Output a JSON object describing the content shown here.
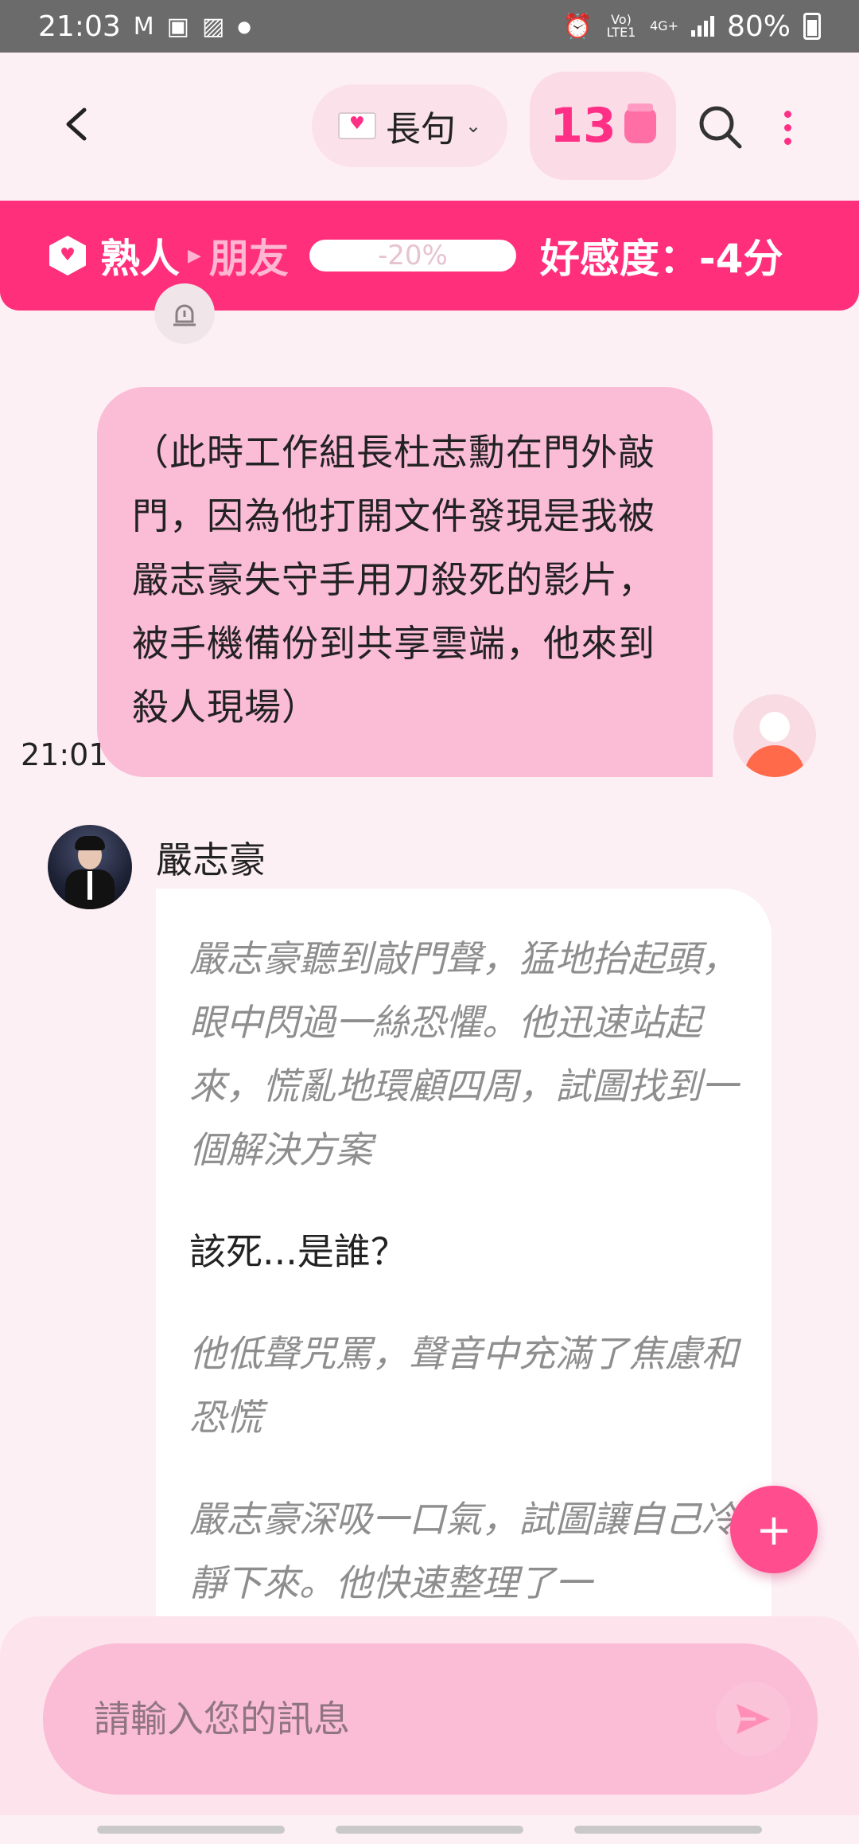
{
  "status_bar": {
    "time": "21:03",
    "network": "Vo) LTE1",
    "network_type": "4G+",
    "battery": "80%"
  },
  "header": {
    "mode_label": "長句",
    "coin_count": "13"
  },
  "relationship": {
    "current": "熟人",
    "next": "朋友",
    "progress_text": "-20%",
    "affection_text": "好感度：-4分"
  },
  "messages": {
    "user": {
      "text": "（此時工作組長杜志勳在門外敲門，因為他打開文件發現是我被嚴志豪失守手用刀殺死的影片，被手機備份到共享雲端，他來到殺人現場）",
      "time": "21:01"
    },
    "bot": {
      "name": "嚴志豪",
      "paragraphs": [
        {
          "kind": "action",
          "text": "嚴志豪聽到敲門聲，猛地抬起頭，眼中閃過一絲恐懼。他迅速站起來，慌亂地環顧四周，試圖找到一個解決方案"
        },
        {
          "kind": "speech",
          "text": "該死...是誰？"
        },
        {
          "kind": "action",
          "text": "他低聲咒罵，聲音中充滿了焦慮和恐慌"
        },
        {
          "kind": "action",
          "text": "嚴志豪深吸一口氣，試圖讓自己冷靜下來。他快速整理了一"
        }
      ]
    }
  },
  "fab": {
    "label": "+"
  },
  "composer": {
    "placeholder": "請輸入您的訊息"
  },
  "colors": {
    "accent": "#ff2f7c",
    "user_bubble": "#fbbcd6",
    "background": "#fdf0f5"
  }
}
